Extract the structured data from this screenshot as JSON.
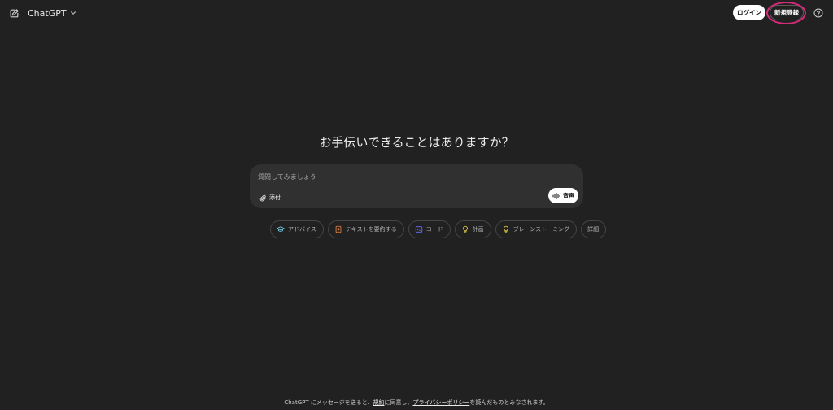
{
  "header": {
    "model_name": "ChatGPT",
    "login_label": "ログイン",
    "signup_label": "新規登録"
  },
  "hero": {
    "headline": "お手伝いできることはありますか？"
  },
  "composer": {
    "placeholder": "質問してみましょう",
    "value": "",
    "attach_label": "添付",
    "voice_label": "音声"
  },
  "chips": [
    {
      "label": "アドバイス",
      "icon": "graduation-cap-icon",
      "color": "#76d0eb"
    },
    {
      "label": "テキストを要約する",
      "icon": "document-icon",
      "color": "#ea8444"
    },
    {
      "label": "コード",
      "icon": "code-icon",
      "color": "#6c71ff"
    },
    {
      "label": "計画",
      "icon": "lightbulb-icon",
      "color": "#e2c541"
    },
    {
      "label": "ブレーンストーミング",
      "icon": "lightbulb-icon",
      "color": "#e2c541"
    },
    {
      "label": "詳細",
      "icon": "",
      "color": ""
    }
  ],
  "footer": {
    "prefix": "ChatGPT にメッセージを送ると、",
    "terms_link": "規約",
    "middle": "に同意し、",
    "privacy_link": "プライバシーポリシー",
    "suffix": "を読んだものとみなされます。"
  },
  "colors": {
    "background": "#212121",
    "composer": "#303030",
    "highlight": "#d62a7a"
  }
}
